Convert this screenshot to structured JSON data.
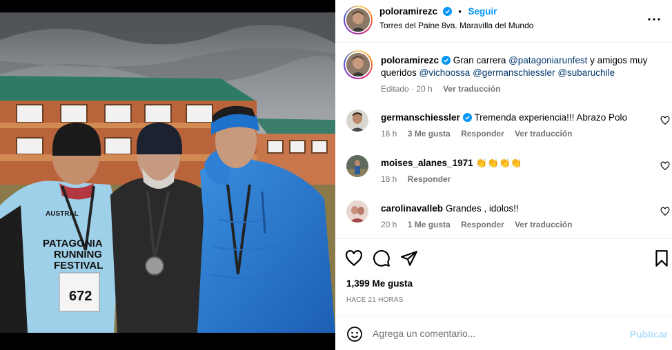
{
  "post": {
    "author": "poloramirezc",
    "follow_label": "Seguir",
    "location": "Torres del Paine 8va. Maravilla del Mundo",
    "separator": "•"
  },
  "caption": {
    "username": "poloramirezc",
    "text_1": "Gran carrera ",
    "mention_1": "@patagoniarunfest",
    "text_2": " y amigos muy queridos ",
    "mention_2": "@vichoossa",
    "mention_3": "@germanschiessler",
    "mention_4": "@subaruchile",
    "edited": "Editado · 20 h",
    "translate": "Ver traducción"
  },
  "comments": [
    {
      "username": "germanschiessler",
      "text": "Tremenda experiencia!!! Abrazo Polo",
      "time": "16 h",
      "likes": "3 Me gusta",
      "reply": "Responder",
      "translate": "Ver traducción",
      "verified": true
    },
    {
      "username": "moises_alanes_1971",
      "text": "👏👏👏👏",
      "time": "18 h",
      "reply": "Responder"
    },
    {
      "username": "carolinavalleb",
      "text": "Grandes , idolos!!",
      "time": "20 h",
      "likes": "1 Me gusta",
      "reply": "Responder",
      "translate": "Ver traducción"
    }
  ],
  "stats": {
    "likes": "1,399 Me gusta",
    "ago": "HACE 21 HORAS"
  },
  "composer": {
    "placeholder": "Agrega un comentario...",
    "publish": "Publicar"
  },
  "photo": {
    "bib_number": "672",
    "shirt_text_1": "PATAGONIA",
    "shirt_text_2": "RUNNING",
    "shirt_text_3": "FESTIVAL",
    "shirt_brand": "AUSTRAL"
  },
  "colors": {
    "accent": "#0095f6",
    "mention": "#00376b",
    "muted": "#737373",
    "publish_disabled": "#b2dffc"
  }
}
